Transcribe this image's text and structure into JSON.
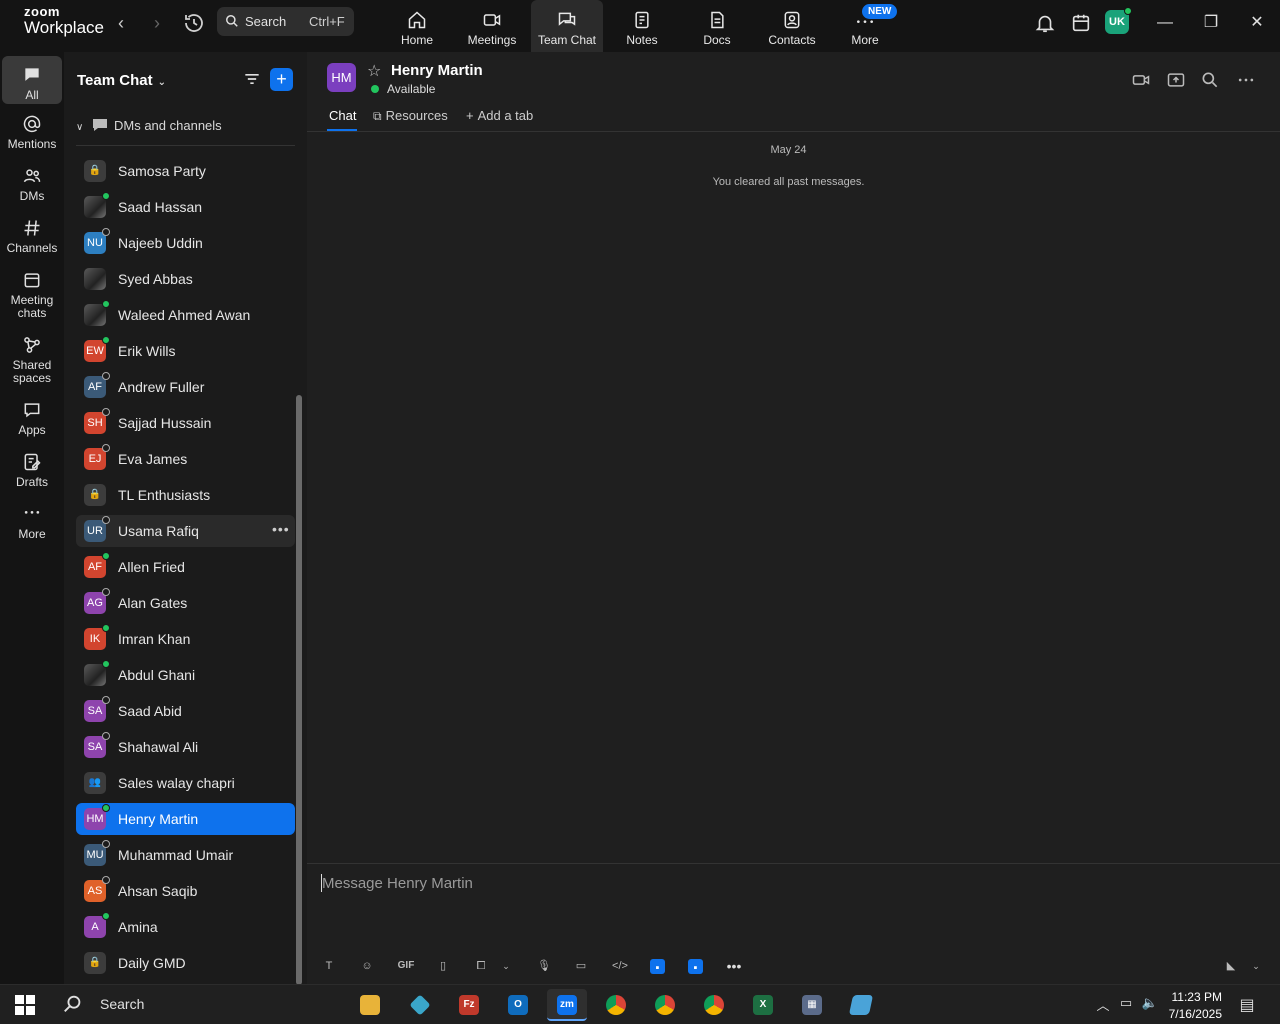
{
  "app": {
    "brand_small": "zoom",
    "brand_name": "Workplace"
  },
  "topbar": {
    "search_label": "Search",
    "search_shortcut": "Ctrl+F",
    "tabs": [
      {
        "label": "Home",
        "icon": "home-icon"
      },
      {
        "label": "Meetings",
        "icon": "video-icon"
      },
      {
        "label": "Team Chat",
        "icon": "chat-icon",
        "active": true
      },
      {
        "label": "Notes",
        "icon": "notes-icon"
      },
      {
        "label": "Docs",
        "icon": "docs-icon"
      },
      {
        "label": "Contacts",
        "icon": "contacts-icon"
      },
      {
        "label": "More",
        "icon": "more-icon"
      }
    ],
    "new_badge": "NEW",
    "user_initials": "UK"
  },
  "rail": {
    "items": [
      {
        "label": "All",
        "active": true
      },
      {
        "label": "Mentions"
      },
      {
        "label": "DMs"
      },
      {
        "label": "Channels"
      },
      {
        "label": "Meeting chats"
      },
      {
        "label": "Shared spaces"
      },
      {
        "label": "Apps"
      },
      {
        "label": "Drafts"
      },
      {
        "label": "More"
      }
    ]
  },
  "sidebar": {
    "title": "Team Chat",
    "section": "DMs and channels",
    "items": [
      {
        "name": "Samosa Party",
        "type": "lock"
      },
      {
        "name": "Saad Hassan",
        "type": "photo",
        "status": "on"
      },
      {
        "name": "Najeeb Uddin",
        "initials": "NU",
        "color": "#2d7fc1",
        "status": "off"
      },
      {
        "name": "Syed Abbas",
        "type": "photo",
        "status": "none"
      },
      {
        "name": "Waleed Ahmed Awan",
        "type": "photo",
        "status": "on"
      },
      {
        "name": "Erik Wills",
        "initials": "EW",
        "color": "#d2452f",
        "status": "on"
      },
      {
        "name": "Andrew Fuller",
        "initials": "AF",
        "color": "#3b5a78",
        "status": "off"
      },
      {
        "name": "Sajjad Hussain",
        "initials": "SH",
        "color": "#d2452f",
        "status": "off"
      },
      {
        "name": "Eva James",
        "initials": "EJ",
        "color": "#d2452f",
        "status": "off"
      },
      {
        "name": "TL Enthusiasts",
        "type": "lock"
      },
      {
        "name": "Usama Rafiq",
        "initials": "UR",
        "color": "#3b5a78",
        "status": "off",
        "hover": true
      },
      {
        "name": "Allen Fried",
        "initials": "AF",
        "color": "#d2452f",
        "status": "on"
      },
      {
        "name": "Alan Gates",
        "initials": "AG",
        "color": "#8e44ad",
        "status": "off"
      },
      {
        "name": "Imran Khan",
        "initials": "IK",
        "color": "#d2452f",
        "status": "on"
      },
      {
        "name": "Abdul Ghani",
        "type": "photo",
        "status": "on"
      },
      {
        "name": "Saad Abid",
        "initials": "SA",
        "color": "#8e44ad",
        "status": "off"
      },
      {
        "name": "Shahawal Ali",
        "initials": "SA",
        "color": "#8e44ad",
        "status": "off"
      },
      {
        "name": "Sales walay chapri",
        "type": "group"
      },
      {
        "name": "Henry Martin",
        "initials": "HM",
        "color": "#8e44ad",
        "status": "on",
        "selected": true
      },
      {
        "name": "Muhammad Umair",
        "initials": "MU",
        "color": "#3b5a78",
        "status": "off"
      },
      {
        "name": "Ahsan Saqib",
        "initials": "AS",
        "color": "#e0622a",
        "status": "off"
      },
      {
        "name": "Amina",
        "initials": "A",
        "color": "#8e44ad",
        "status": "on"
      },
      {
        "name": "Daily GMD",
        "type": "lock"
      }
    ]
  },
  "chat": {
    "contact_initials": "HM",
    "contact_name": "Henry Martin",
    "contact_status": "Available",
    "tabs": [
      "Chat",
      "Resources",
      "Add a tab"
    ],
    "date_label": "May 24",
    "system_message": "You cleared all past messages.",
    "composer_placeholder": "Message Henry Martin",
    "composer_tools": [
      "format-icon",
      "emoji-icon",
      "GIF",
      "file-icon",
      "screenshot-icon",
      "mic-icon",
      "video-clip-icon",
      "code-icon",
      "app1-icon",
      "app2-icon",
      "more-icon"
    ]
  },
  "taskbar": {
    "search_label": "Search",
    "time": "11:23 PM",
    "date": "7/16/2025"
  },
  "colors": {
    "accent": "#0e72ed",
    "online": "#22c55e"
  }
}
